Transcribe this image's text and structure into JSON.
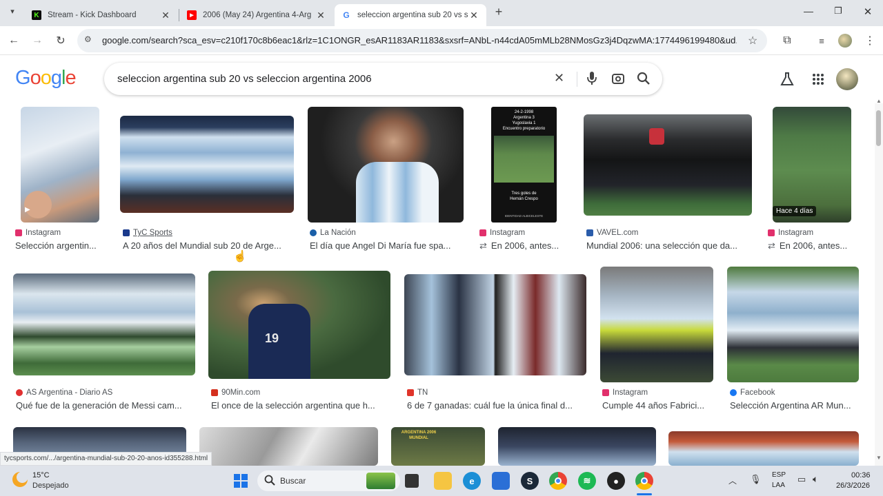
{
  "tabs": [
    {
      "title": "Stream - Kick Dashboard",
      "favicon": "kick-icon",
      "color": "#53fc18"
    },
    {
      "title": "2006 (May 24) Argentina 4-Arg",
      "favicon": "youtube-icon",
      "color": "#ff0000"
    },
    {
      "title": "seleccion argentina sub 20 vs s",
      "favicon": "google-icon",
      "color": "#4285f4"
    }
  ],
  "new_tab": "+",
  "address_url": "google.com/search?sca_esv=c210f170c8b6eac1&rlz=1C1ONGR_esAR1183AR1183&sxsrf=ANbL-n44cdA05mMLb28NMosGz3j4DqzwMA:1774496199480&ud...",
  "logo": "Google",
  "query": "seleccion argentina sub 20 vs seleccion argentina 2006",
  "results_row1": [
    {
      "source": "Instagram",
      "title": "Selección argentin...",
      "src_color": "#e1306c"
    },
    {
      "source": "TyC Sports",
      "title": "A 20 años del Mundial sub 20 de Arge...",
      "src_color": "#1a3a8c"
    },
    {
      "source": "La Nación",
      "title": "El día que Angel Di María fue spa...",
      "src_color": "#1a5fa8"
    },
    {
      "source": "Instagram",
      "title": "En 2006, antes...",
      "src_color": "#e1306c",
      "title_prefix": "⇄"
    },
    {
      "source": "VAVEL.com",
      "title": "Mundial 2006: una selección que da...",
      "src_color": "#2a5caa"
    },
    {
      "source": "Instagram",
      "title": "En 2006, antes...",
      "src_color": "#e1306c",
      "title_prefix": "⇄",
      "badge": "Hace 4 días"
    }
  ],
  "results_row2": [
    {
      "source": "AS Argentina - Diario AS",
      "title": "Qué fue de la generación de Messi cam...",
      "src_color": "#e03030"
    },
    {
      "source": "90Min.com",
      "title": "El once de la selección argentina que h...",
      "src_color": "#d4301e"
    },
    {
      "source": "TN",
      "title": "6 de 7 ganadas: cuál fue la única final d...",
      "src_color": "#e0342a"
    },
    {
      "source": "Instagram",
      "title": "Cumple 44 años Fabrici...",
      "src_color": "#e1306c"
    },
    {
      "source": "Facebook",
      "title": "Selección Argentina AR Mun...",
      "src_color": "#1877f2"
    }
  ],
  "thumb_text": {
    "card4_lines": [
      "24-2-1998",
      "Argentina 3",
      "Yugoslavia 1",
      "Encuentro preparatorio"
    ],
    "card4_bottom": [
      "Tres goles de",
      "Hernán Crespo"
    ],
    "card4_footer": "IDENTIDAD ALBICELESTE",
    "card9_jersey": "19",
    "row3_logo": "ARGENTINA 2006 MUNDIAL"
  },
  "status_url": "tycsports.com/.../argentina-mundial-sub-20-20-anos-id355288.html",
  "taskbar": {
    "weather_temp": "15°C",
    "weather_desc": "Despejado",
    "search_label": "Buscar",
    "lang_top": "ESP",
    "lang_bottom": "LAA",
    "time": "00:36",
    "date": "26/3/2026"
  }
}
